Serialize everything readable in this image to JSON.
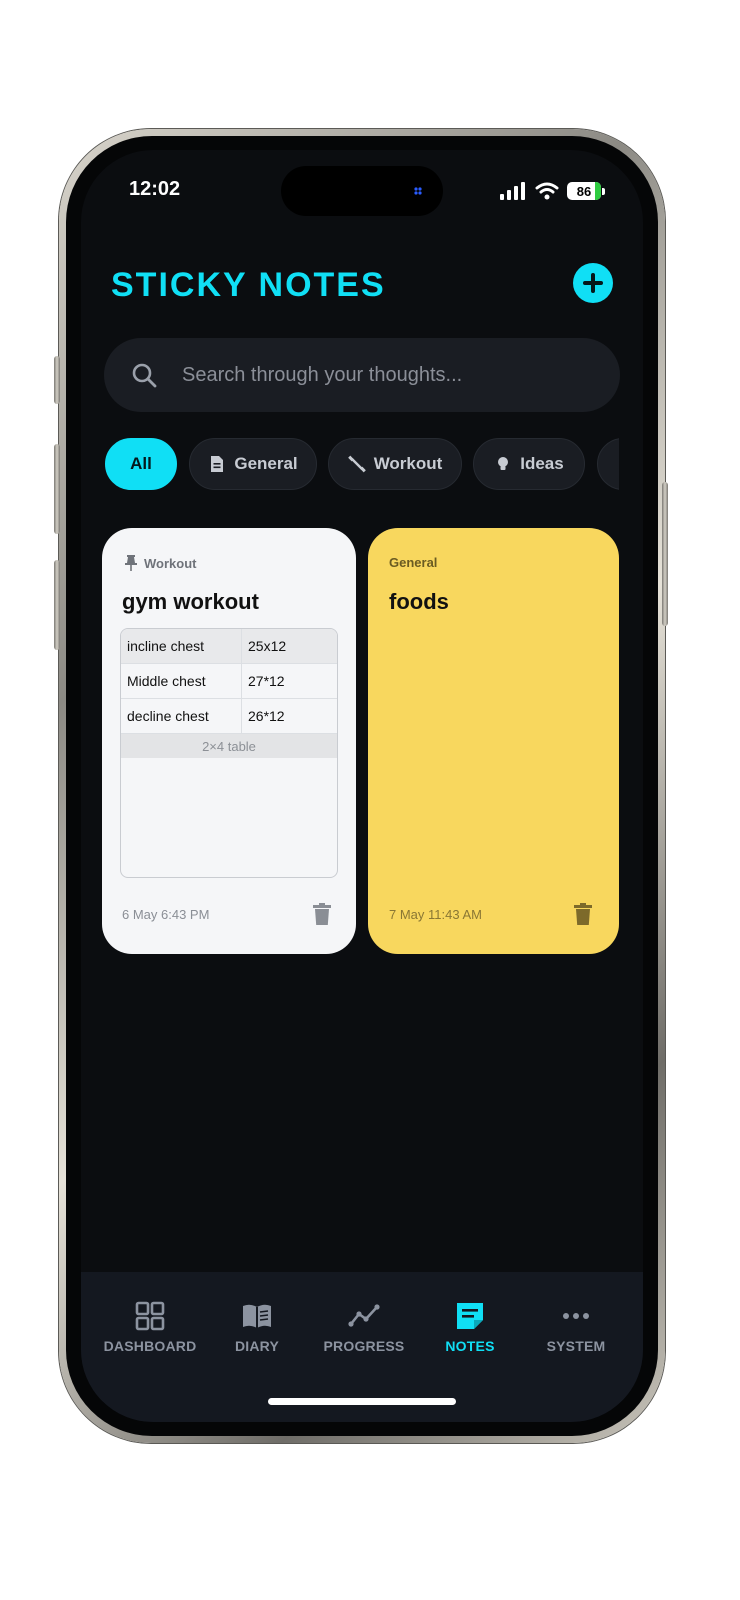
{
  "status_bar": {
    "time": "12:02",
    "battery": "86"
  },
  "header": {
    "title": "STICKY NOTES"
  },
  "search": {
    "placeholder": "Search through your thoughts..."
  },
  "filters": [
    {
      "label": "All",
      "icon": "none",
      "active": true
    },
    {
      "label": "General",
      "icon": "document-icon",
      "active": false
    },
    {
      "label": "Workout",
      "icon": "dumbbell-icon",
      "active": false
    },
    {
      "label": "Ideas",
      "icon": "lightbulb-icon",
      "active": false
    }
  ],
  "notes": [
    {
      "category": "Workout",
      "pinned": true,
      "title": "gym workout",
      "table": {
        "rows": [
          [
            "incline chest",
            "25x12"
          ],
          [
            "Middle chest",
            "27*12"
          ],
          [
            "decline chest",
            "26*12"
          ]
        ],
        "footer": "2×4 table"
      },
      "date": "6 May 6:43 PM",
      "color": "#f5f6f8"
    },
    {
      "category": "General",
      "pinned": false,
      "title": "foods",
      "date": "7 May 11:43 AM",
      "color": "#f8d75e"
    }
  ],
  "bottom_nav": [
    {
      "label": "DASHBOARD",
      "icon": "grid-icon",
      "active": false
    },
    {
      "label": "DIARY",
      "icon": "book-icon",
      "active": false
    },
    {
      "label": "PROGRESS",
      "icon": "trend-line-icon",
      "active": false
    },
    {
      "label": "NOTES",
      "icon": "note-icon",
      "active": true
    },
    {
      "label": "SYSTEM",
      "icon": "more-dots-icon",
      "active": false
    }
  ],
  "colors": {
    "accent": "#10dff5",
    "background": "#0b0d10",
    "surface": "#1a1d23"
  }
}
